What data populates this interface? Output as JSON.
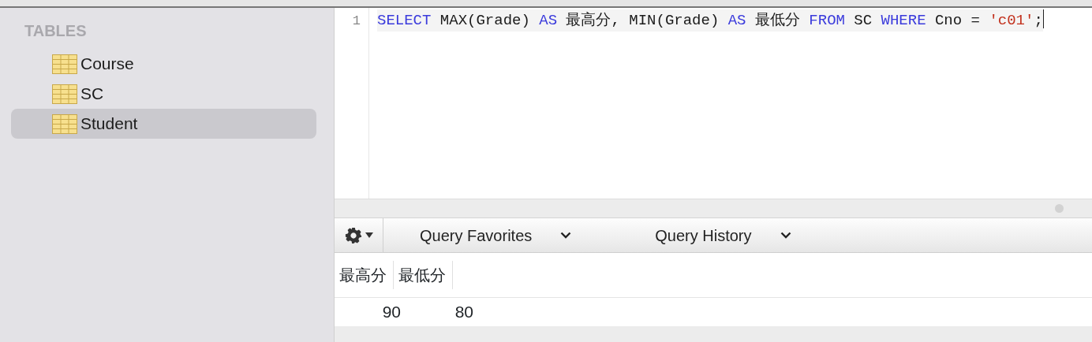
{
  "sidebar": {
    "heading": "TABLES",
    "items": [
      {
        "label": "Course",
        "selected": false
      },
      {
        "label": "SC",
        "selected": false
      },
      {
        "label": "Student",
        "selected": true
      }
    ]
  },
  "editor": {
    "lines": [
      {
        "number": "1",
        "tokens": [
          {
            "kind": "keyword",
            "text": "SELECT"
          },
          {
            "kind": "plain",
            "text": " MAX(Grade) "
          },
          {
            "kind": "keyword",
            "text": "AS"
          },
          {
            "kind": "plain",
            "text": " 最高分, MIN(Grade) "
          },
          {
            "kind": "keyword",
            "text": "AS"
          },
          {
            "kind": "plain",
            "text": " 最低分 "
          },
          {
            "kind": "keyword",
            "text": "FROM"
          },
          {
            "kind": "plain",
            "text": " SC "
          },
          {
            "kind": "keyword",
            "text": "WHERE"
          },
          {
            "kind": "plain",
            "text": " Cno = "
          },
          {
            "kind": "string",
            "text": "'c01'"
          },
          {
            "kind": "plain",
            "text": ";"
          }
        ]
      }
    ]
  },
  "toolbar": {
    "menus": [
      "Query Favorites",
      "Query History"
    ]
  },
  "results": {
    "columns": [
      "最高分",
      "最低分"
    ],
    "rows": [
      [
        "90",
        "80"
      ]
    ]
  }
}
